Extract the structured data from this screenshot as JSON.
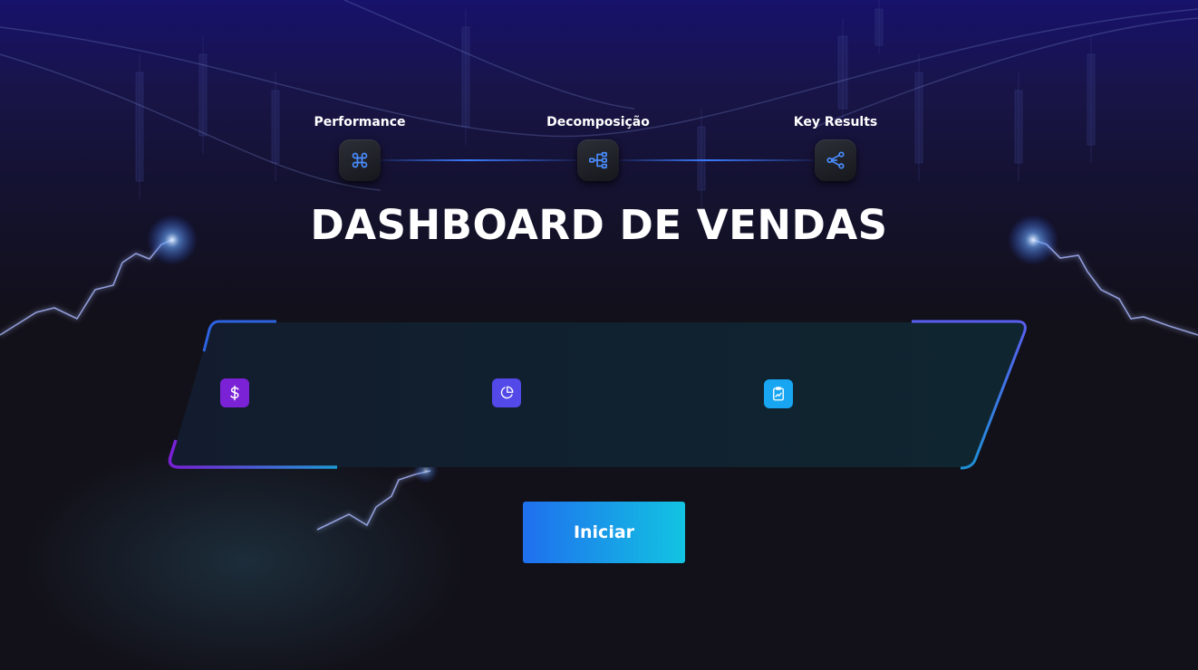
{
  "steps": [
    {
      "label": "Performance",
      "icon": "command-icon"
    },
    {
      "label": "Decomposição",
      "icon": "hierarchy-icon"
    },
    {
      "label": "Key Results",
      "icon": "share-icon"
    }
  ],
  "title": "DASHBOARD DE VENDAS",
  "kpi_icons": [
    {
      "icon": "dollar-icon",
      "color": "#7b22d6"
    },
    {
      "icon": "pie-chart-icon",
      "color": "#5348e8"
    },
    {
      "icon": "chart-clipboard-icon",
      "color": "#18a6f2"
    }
  ],
  "start_button": {
    "label": "Iniciar"
  },
  "colors": {
    "accent_blue": "#3b7bff",
    "accent_purple": "#7b22d6",
    "accent_cyan": "#12c4e2",
    "background": "#121018"
  }
}
